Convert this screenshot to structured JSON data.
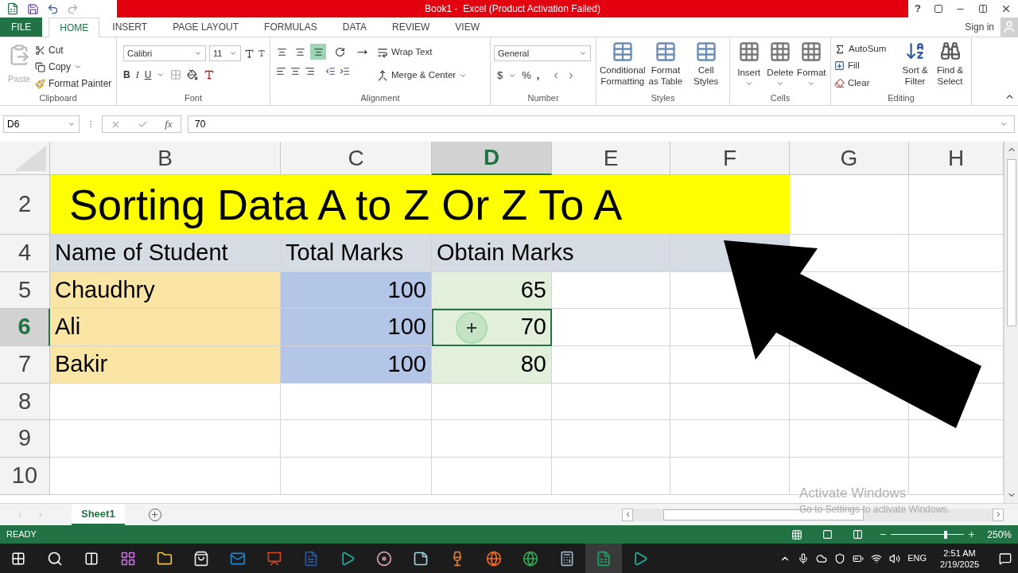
{
  "window": {
    "title": "Book1 -  Excel (Product Activation Failed)",
    "help": "?",
    "sign_in": "Sign in"
  },
  "tabs": [
    {
      "label": "FILE",
      "kind": "file",
      "selected": false
    },
    {
      "label": "HOME",
      "kind": "tab",
      "selected": true
    },
    {
      "label": "INSERT",
      "kind": "tab",
      "selected": false
    },
    {
      "label": "PAGE LAYOUT",
      "kind": "tab",
      "selected": false
    },
    {
      "label": "FORMULAS",
      "kind": "tab",
      "selected": false
    },
    {
      "label": "DATA",
      "kind": "tab",
      "selected": false
    },
    {
      "label": "REVIEW",
      "kind": "tab",
      "selected": false
    },
    {
      "label": "VIEW",
      "kind": "tab",
      "selected": false
    }
  ],
  "ribbon": {
    "clipboard": {
      "label": "Clipboard",
      "paste": "Paste",
      "cut": "Cut",
      "copy": "Copy",
      "format_painter": "Format Painter"
    },
    "font": {
      "label": "Font",
      "font_name": "Calibri",
      "font_size": "11",
      "bold": "B",
      "italic": "I",
      "underline": "U"
    },
    "alignment": {
      "label": "Alignment",
      "vertical": [
        {
          "selected": false
        },
        {
          "selected": false
        },
        {
          "selected": true
        }
      ],
      "wrap_text": "Wrap Text",
      "merge_center": "Merge & Center"
    },
    "number": {
      "label": "Number",
      "format": "General",
      "currency": "$",
      "percent": "%",
      "comma": ","
    },
    "styles": {
      "label": "Styles",
      "buttons": [
        "Conditional Formatting",
        "Format as Table",
        "Cell Styles"
      ]
    },
    "cells": {
      "label": "Cells",
      "buttons": [
        "Insert",
        "Delete",
        "Format"
      ]
    },
    "editing": {
      "label": "Editing",
      "autosum": "AutoSum",
      "fill": "Fill",
      "clear": "Clear",
      "sort_filter": "Sort & Filter",
      "find_select": "Find & Select"
    }
  },
  "formula_bar": {
    "name_box": "D6",
    "function": "fx",
    "value": "70"
  },
  "columns": [
    {
      "label": "B",
      "selected": false
    },
    {
      "label": "C",
      "selected": false
    },
    {
      "label": "D",
      "selected": true
    },
    {
      "label": "E",
      "selected": false
    },
    {
      "label": "F",
      "selected": false
    },
    {
      "label": "G",
      "selected": false
    },
    {
      "label": "H",
      "selected": false
    }
  ],
  "rows": [
    {
      "header": "2",
      "kind": "title",
      "selected": false,
      "cells": [
        "Sorting Data A to Z Or Z To A"
      ]
    },
    {
      "header": "4",
      "kind": "header",
      "selected": false,
      "cells": [
        "Name of Student",
        "Total Marks",
        "Obtain Marks"
      ]
    },
    {
      "header": "5",
      "kind": "data",
      "selected": false,
      "cells": [
        "Chaudhry",
        "100",
        "65"
      ]
    },
    {
      "header": "6",
      "kind": "data",
      "selected": true,
      "cells": [
        "Ali",
        "100",
        "70"
      ]
    },
    {
      "header": "7",
      "kind": "data",
      "selected": false,
      "cells": [
        "Bakir",
        "100",
        "80"
      ]
    },
    {
      "header": "8",
      "kind": "empty",
      "selected": false,
      "cells": []
    },
    {
      "header": "9",
      "kind": "empty",
      "selected": false,
      "cells": []
    },
    {
      "header": "10",
      "kind": "empty",
      "selected": false,
      "cells": []
    }
  ],
  "sheet_tabs": [
    {
      "label": "Sheet1",
      "selected": true
    }
  ],
  "activation": {
    "title": "Activate Windows",
    "subtitle": "Go to Settings to activate Windows."
  },
  "status_bar": {
    "status": "READY",
    "zoom": "250%",
    "zoom_slider": {
      "level": 0.75
    }
  },
  "taskbar": {
    "language": "ENG",
    "time": "2:51 AM",
    "date": "2/19/2025"
  }
}
